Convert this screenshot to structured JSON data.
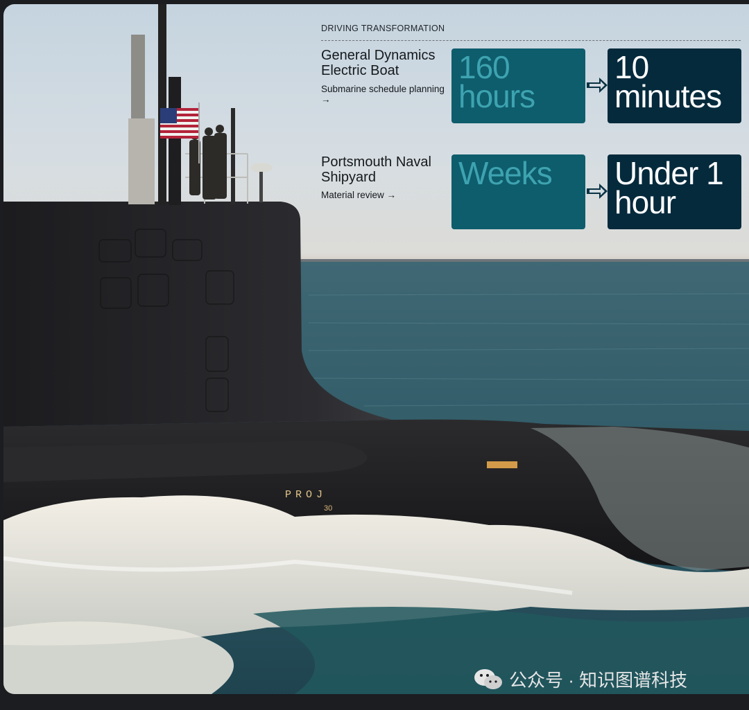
{
  "header": {
    "eyebrow": "DRIVING TRANSFORMATION"
  },
  "cases": [
    {
      "title": "General Dynamics Electric Boat",
      "subtitle": "Submarine schedule planning →",
      "before": "160 hours",
      "after": "10 minutes"
    },
    {
      "title": "Portsmouth Naval Shipyard",
      "subtitle": "Material review →",
      "before": "Weeks",
      "after": "Under 1 hour"
    }
  ],
  "photo": {
    "hull_marking": "PROJ",
    "hull_number": "30"
  },
  "watermark": {
    "icon": "wechat-icon",
    "text": "公众号 · 知识图谱科技"
  },
  "colors": {
    "tile_before": "#0e5d6c",
    "tile_before_text": "#3ea3b0",
    "tile_after": "#052a3c",
    "tile_after_text": "#ffffff"
  }
}
